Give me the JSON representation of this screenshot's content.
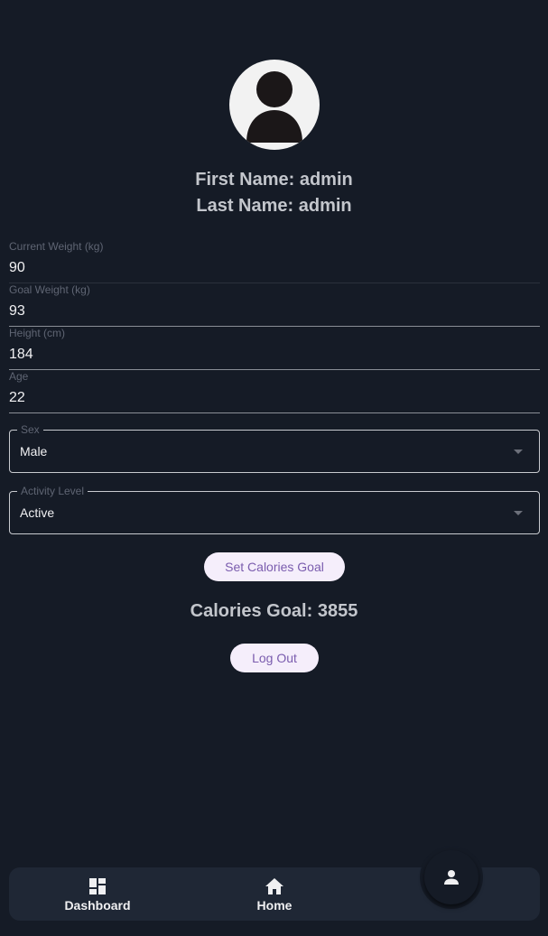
{
  "profile": {
    "first_name": "First Name: admin",
    "last_name": "Last Name: admin"
  },
  "fields": {
    "current_weight": {
      "label": "Current Weight (kg)",
      "value": "90"
    },
    "goal_weight": {
      "label": "Goal Weight (kg)",
      "value": "93"
    },
    "height": {
      "label": "Height (cm)",
      "value": "184"
    },
    "age": {
      "label": "Age",
      "value": "22"
    }
  },
  "selects": {
    "sex": {
      "label": "Sex",
      "value": "Male"
    },
    "activity": {
      "label": "Activity Level",
      "value": "Active"
    }
  },
  "actions": {
    "set_goal": "Set Calories Goal",
    "logout": "Log Out"
  },
  "calories_goal": "Calories Goal: 3855",
  "nav": {
    "dashboard": "Dashboard",
    "home": "Home",
    "profile_icon": "person-icon"
  },
  "colors": {
    "background": "#151b26",
    "navbar": "#1f2735",
    "button_bg": "#f5eefb",
    "button_text": "#7a5cae"
  }
}
